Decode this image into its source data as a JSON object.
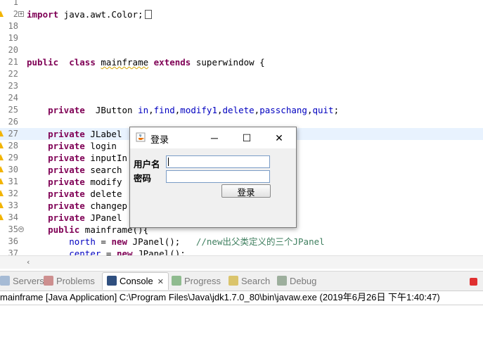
{
  "editor": {
    "lines": [
      {
        "num": "1",
        "parts": []
      },
      {
        "num": "2",
        "parts": [
          {
            "t": "import",
            "c": "kw"
          },
          {
            "t": " java.awt.Color;",
            "c": ""
          }
        ]
      },
      {
        "num": "18",
        "parts": []
      },
      {
        "num": "19",
        "parts": []
      },
      {
        "num": "20",
        "parts": []
      },
      {
        "num": "21",
        "parts": [
          {
            "t": "public",
            "c": "kw"
          },
          {
            "t": "  ",
            "c": ""
          },
          {
            "t": "class",
            "c": "kw"
          },
          {
            "t": " ",
            "c": ""
          },
          {
            "t": "mainframe",
            "c": "squig"
          },
          {
            "t": " ",
            "c": ""
          },
          {
            "t": "extends",
            "c": "kw"
          },
          {
            "t": " superwindow {",
            "c": ""
          }
        ]
      },
      {
        "num": "22",
        "parts": []
      },
      {
        "num": "23",
        "parts": []
      },
      {
        "num": "24",
        "parts": []
      },
      {
        "num": "25",
        "parts": [
          {
            "t": "    private",
            "c": "kw"
          },
          {
            "t": "  JButton ",
            "c": ""
          },
          {
            "t": "in",
            "c": "fld"
          },
          {
            "t": ",",
            "c": ""
          },
          {
            "t": "find",
            "c": "fld"
          },
          {
            "t": ",",
            "c": ""
          },
          {
            "t": "modify1",
            "c": "fld"
          },
          {
            "t": ",",
            "c": ""
          },
          {
            "t": "delete",
            "c": "fld"
          },
          {
            "t": ",",
            "c": ""
          },
          {
            "t": "passchang",
            "c": "fld"
          },
          {
            "t": ",",
            "c": ""
          },
          {
            "t": "quit",
            "c": "fld"
          },
          {
            "t": ";",
            "c": ""
          }
        ]
      },
      {
        "num": "26",
        "parts": []
      },
      {
        "num": "27",
        "parts": [
          {
            "t": "    private",
            "c": "kw"
          },
          {
            "t": " JLabel",
            "c": ""
          }
        ]
      },
      {
        "num": "28",
        "parts": [
          {
            "t": "    private",
            "c": "kw"
          },
          {
            "t": " login",
            "c": ""
          }
        ]
      },
      {
        "num": "29",
        "parts": [
          {
            "t": "    private",
            "c": "kw"
          },
          {
            "t": " inputIn",
            "c": ""
          }
        ]
      },
      {
        "num": "30",
        "parts": [
          {
            "t": "    private",
            "c": "kw"
          },
          {
            "t": " search",
            "c": ""
          }
        ]
      },
      {
        "num": "31",
        "parts": [
          {
            "t": "    private",
            "c": "kw"
          },
          {
            "t": " modify",
            "c": ""
          }
        ]
      },
      {
        "num": "32",
        "parts": [
          {
            "t": "    private",
            "c": "kw"
          },
          {
            "t": " delete",
            "c": ""
          }
        ]
      },
      {
        "num": "33",
        "parts": [
          {
            "t": "    private",
            "c": "kw"
          },
          {
            "t": " changep",
            "c": ""
          }
        ]
      },
      {
        "num": "34",
        "parts": [
          {
            "t": "    private",
            "c": "kw"
          },
          {
            "t": " JPanel",
            "c": ""
          }
        ]
      },
      {
        "num": "35",
        "parts": [
          {
            "t": "    public",
            "c": "kw"
          },
          {
            "t": " mainframe(){",
            "c": ""
          }
        ]
      },
      {
        "num": "36",
        "parts": [
          {
            "t": "        ",
            "c": ""
          },
          {
            "t": "north",
            "c": "fld"
          },
          {
            "t": " = ",
            "c": ""
          },
          {
            "t": "new",
            "c": "kw"
          },
          {
            "t": " JPanel();   ",
            "c": ""
          },
          {
            "t": "//new出父类定义的三个JPanel",
            "c": "cm"
          }
        ]
      },
      {
        "num": "37",
        "parts": [
          {
            "t": "        ",
            "c": ""
          },
          {
            "t": "center",
            "c": "fld"
          },
          {
            "t": " = ",
            "c": ""
          },
          {
            "t": "new",
            "c": "kw"
          },
          {
            "t": " JPanel();",
            "c": ""
          }
        ]
      }
    ]
  },
  "views": {
    "tabs": [
      {
        "label": "Servers",
        "icon": "servers-icon",
        "active": false
      },
      {
        "label": "Problems",
        "icon": "problems-icon",
        "active": false
      },
      {
        "label": "Console",
        "icon": "console-icon",
        "active": true
      },
      {
        "label": "Progress",
        "icon": "progress-icon",
        "active": false
      },
      {
        "label": "Search",
        "icon": "search-icon",
        "active": false
      },
      {
        "label": "Debug",
        "icon": "debug-icon",
        "active": false
      }
    ],
    "console_label": "mainframe [Java Application] C:\\Program Files\\Java\\jdk1.7.0_80\\bin\\javaw.exe (2019年6月26日 下午1:40:47)"
  },
  "dialog": {
    "title": "登录",
    "username_label": "用户名",
    "password_label": "密码",
    "username_value": "",
    "password_value": "",
    "login_button": "登录",
    "minimize_glyph": "─",
    "maximize_glyph": "☐",
    "close_glyph": "✕"
  },
  "colors": {
    "keyword": "#7f0055",
    "field": "#0000c0",
    "comment": "#3f7f5f",
    "current_line": "#e8f2fe",
    "stop_button": "#e03030"
  }
}
